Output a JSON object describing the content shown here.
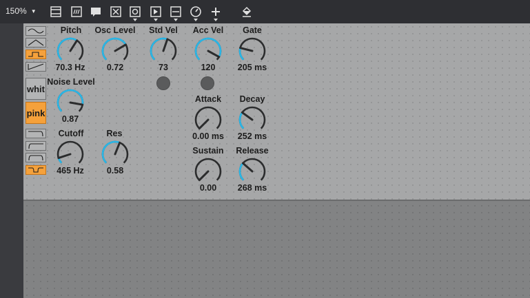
{
  "toolbar": {
    "zoom_label": "150%",
    "icons": [
      "presentation-icon",
      "text-field-icon",
      "comment-icon",
      "toggle-icon",
      "radio-icon",
      "play-button-icon",
      "slider-icon",
      "dial-icon",
      "add-icon",
      "paint-bucket-icon"
    ]
  },
  "colors": {
    "accent": "#f5a13b",
    "knob_arc": "#29b6e6",
    "panel": "#a6a7a8",
    "toolbar": "#2e2f33"
  },
  "waveforms": [
    "sine",
    "triangle",
    "square",
    "sawtooth"
  ],
  "waveform_selected": "square",
  "noise_types": {
    "white_label": "whit",
    "pink_label": "pink",
    "selected": "pink"
  },
  "filter_types": [
    "lowpass",
    "highpass",
    "bandpass",
    "notch"
  ],
  "filter_selected": "notch",
  "knobs": {
    "pitch": {
      "label": "Pitch",
      "value": "70.3 Hz",
      "level": 0.62
    },
    "osc_level": {
      "label": "Osc Level",
      "value": "0.72",
      "level": 0.72
    },
    "std_vel": {
      "label": "Std Vel",
      "value": "73",
      "level": 0.57
    },
    "acc_vel": {
      "label": "Acc Vel",
      "value": "120",
      "level": 0.94
    },
    "gate": {
      "label": "Gate",
      "value": "205 ms",
      "level": 0.22
    },
    "noise_level": {
      "label": "Noise Level",
      "value": "0.87",
      "level": 0.87
    },
    "attack": {
      "label": "Attack",
      "value": "0.00 ms",
      "level": 0.0
    },
    "decay": {
      "label": "Decay",
      "value": "252 ms",
      "level": 0.3
    },
    "cutoff": {
      "label": "Cutoff",
      "value": "465 Hz",
      "level": 0.1
    },
    "res": {
      "label": "Res",
      "value": "0.58",
      "level": 0.58
    },
    "sustain": {
      "label": "Sustain",
      "value": "0.00",
      "level": 0.0
    },
    "release": {
      "label": "Release",
      "value": "268 ms",
      "level": 0.32
    }
  }
}
